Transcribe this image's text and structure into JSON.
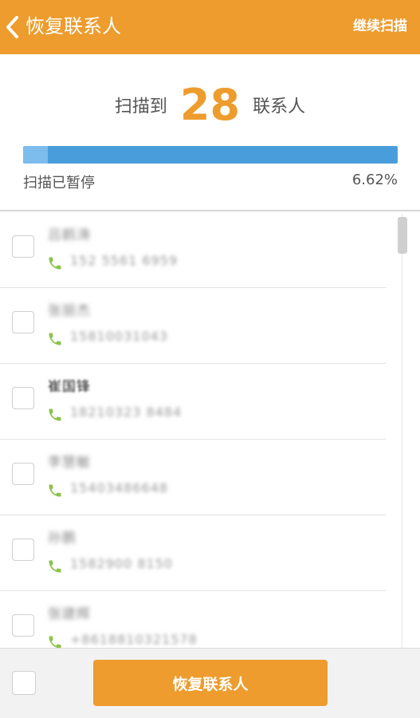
{
  "header": {
    "title": "恢复联系人",
    "action_label": "继续扫描",
    "background": "#ED9C2D"
  },
  "summary": {
    "prefix": "扫描到",
    "count": "28",
    "suffix": "联系人",
    "status": "扫描已暂停",
    "percent_label": "6.62%",
    "progress_fraction": 0.0662,
    "accent_color": "#ED9C2D",
    "progress_color": "#4A9DDB"
  },
  "contacts": [
    {
      "name": "吕鹤涛",
      "phone": "152 5561 6959"
    },
    {
      "name": "张丽杰",
      "phone": "15810031043"
    },
    {
      "name": "崔国锋",
      "phone": "18210323 8484"
    },
    {
      "name": "李慧敏",
      "phone": "15403486648"
    },
    {
      "name": "孙鹏",
      "phone": "1582900 8150"
    },
    {
      "name": "张建辉",
      "phone": "+8618810321578"
    }
  ],
  "footer": {
    "restore_label": "恢复联系人"
  },
  "icons": {
    "back": "chevron-left-icon",
    "phone": "phone-icon"
  }
}
